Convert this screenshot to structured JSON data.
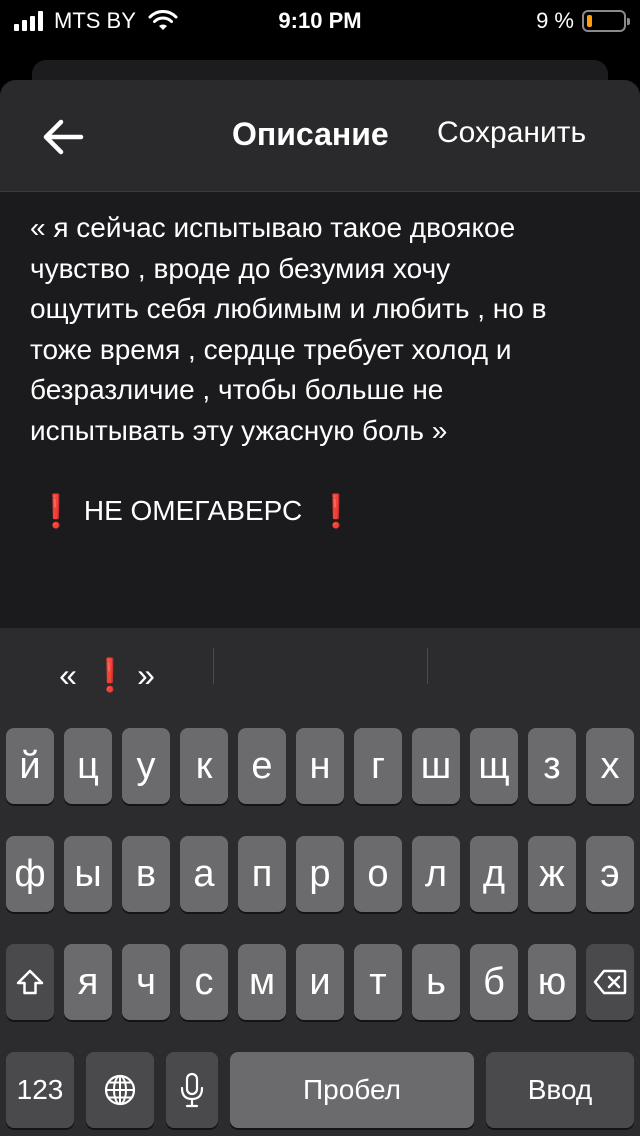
{
  "status": {
    "carrier": "MTS BY",
    "time": "9:10 PM",
    "battery_percent": "9 %",
    "battery_level": 0.09
  },
  "nav": {
    "title": "Описание",
    "save_label": "Сохранить"
  },
  "content": {
    "description": "« я сейчас испытываю такое двоякое\nчувство , вроде до безумия хочу\nощутить себя любимым и любить , но в\nтоже время , сердце требует холод и\nбезразличие , чтобы больше не\nиспытывать эту ужасную боль »",
    "warning_text": "НЕ ОМЕГАВЕРС",
    "warning_mark": "❗"
  },
  "keyboard": {
    "suggestions": [
      "«",
      "❗",
      "»"
    ],
    "row1": [
      "й",
      "ц",
      "у",
      "к",
      "е",
      "н",
      "г",
      "ш",
      "щ",
      "з",
      "х"
    ],
    "row2": [
      "ф",
      "ы",
      "в",
      "а",
      "п",
      "р",
      "о",
      "л",
      "д",
      "ж",
      "э"
    ],
    "row3": [
      "я",
      "ч",
      "с",
      "м",
      "и",
      "т",
      "ь",
      "б",
      "ю"
    ],
    "numbers_label": "123",
    "space_label": "Пробел",
    "return_label": "Ввод",
    "icons": {
      "shift": "shift-icon",
      "delete": "delete-icon",
      "globe": "globe-icon",
      "mic": "microphone-icon"
    }
  },
  "colors": {
    "background": "#000000",
    "sheet": "#1b1b1d",
    "key": "#6b6b6d",
    "key_dark": "#4a4a4c",
    "exclaim": "#ff2020",
    "battery_fill": "#ff9f0a"
  }
}
